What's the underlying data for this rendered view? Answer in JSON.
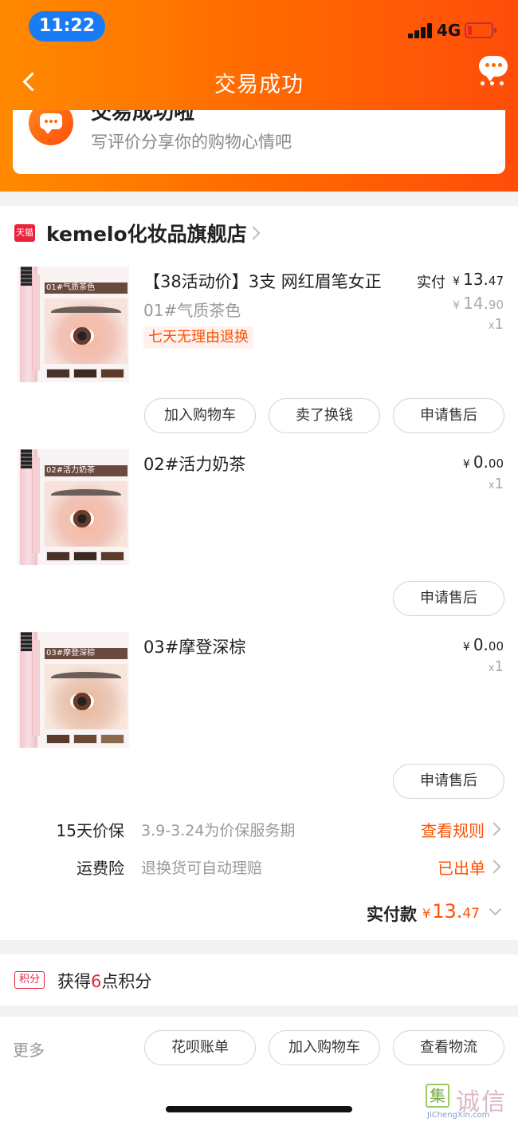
{
  "status_bar": {
    "time": "11:22",
    "network": "4G"
  },
  "nav": {
    "title": "交易成功"
  },
  "success": {
    "title": "交易成功啦",
    "subtitle": "写评价分享你的购物心情吧"
  },
  "shop": {
    "badge": "天猫",
    "name": "kemelo化妆品旗舰店"
  },
  "products": [
    {
      "title": "【38活动价】3支 网红眉笔女正",
      "sku": "01#气质茶色",
      "badge": "七天无理由退换",
      "price_label": "实付",
      "price_currency": "¥",
      "price_int": "13.",
      "price_dec": "47",
      "orig_currency": "¥",
      "orig_int": "14.",
      "orig_dec": "90",
      "qty_x": "x",
      "qty": "1",
      "thumb_tag": "01#气质茶色",
      "buttons": [
        "加入购物车",
        "卖了换钱",
        "申请售后"
      ]
    },
    {
      "title": "02#活力奶茶",
      "price_currency": "¥",
      "price_int": "0.",
      "price_dec": "00",
      "qty_x": "x",
      "qty": "1",
      "thumb_tag": "02#活力奶茶",
      "buttons": [
        "申请售后"
      ]
    },
    {
      "title": "03#摩登深棕",
      "price_currency": "¥",
      "price_int": "0.",
      "price_dec": "00",
      "qty_x": "x",
      "qty": "1",
      "thumb_tag": "03#摩登深棕",
      "buttons": [
        "申请售后"
      ]
    }
  ],
  "services": [
    {
      "label": "15天价保",
      "value": "3.9-3.24为价保服务期",
      "link": "查看规则"
    },
    {
      "label": "运费险",
      "value": "退换货可自动理赔",
      "link": "已出单"
    }
  ],
  "total": {
    "label": "实付款",
    "currency": "¥",
    "int": "13.",
    "dec": "47"
  },
  "points": {
    "badge": "积分",
    "prefix": "获得",
    "count": "6",
    "suffix": "点积分"
  },
  "footer": {
    "more_label": "更多",
    "buttons": [
      "花呗账单",
      "加入购物车",
      "查看物流"
    ]
  },
  "watermark": {
    "mark": "集",
    "text": "诚信",
    "url": "JiChengXin.com"
  },
  "colors": {
    "header_start": "#ff8a00",
    "header_end": "#ff4d0a",
    "accent": "#ff5000",
    "tmall_red": "#e8233c"
  }
}
